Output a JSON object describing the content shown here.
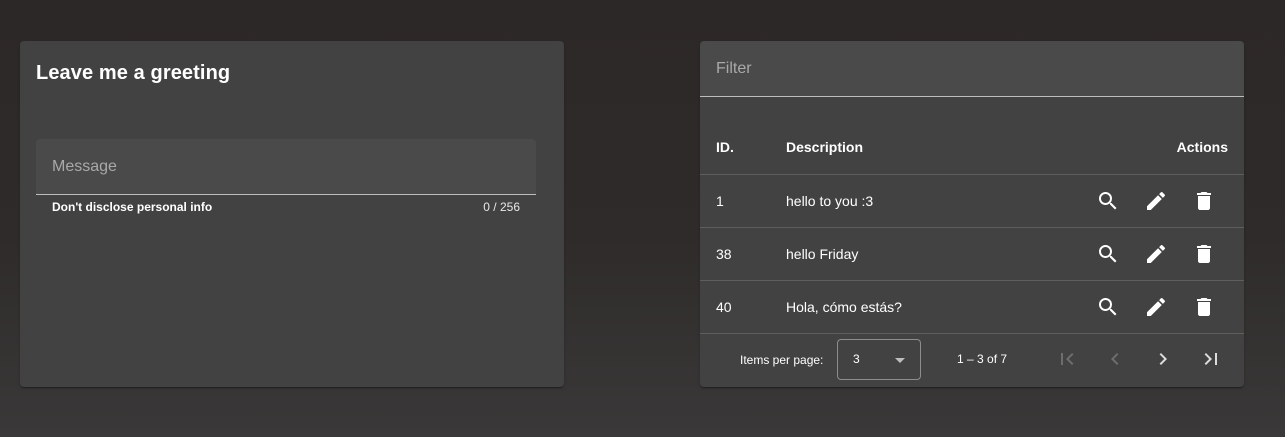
{
  "greeting_card": {
    "title": "Leave me a greeting",
    "message_field": {
      "placeholder": "Message",
      "value": "",
      "hint": "Don't disclose personal info",
      "counter": "0 / 256"
    }
  },
  "table_card": {
    "filter": {
      "placeholder": "Filter",
      "value": ""
    },
    "columns": {
      "id": "ID.",
      "description": "Description",
      "actions": "Actions"
    },
    "rows": [
      {
        "id": "1",
        "description": "hello to you :3"
      },
      {
        "id": "38",
        "description": "hello Friday"
      },
      {
        "id": "40",
        "description": "Hola, cómo estás?"
      }
    ],
    "row_actions": [
      "search-icon",
      "pencil-icon",
      "trash-icon"
    ],
    "paginator": {
      "items_per_page_label": "Items per page:",
      "items_per_page_value": "3",
      "range_label": "1 – 3 of 7",
      "first_enabled": false,
      "prev_enabled": false,
      "next_enabled": true,
      "last_enabled": true
    }
  },
  "colors": {
    "background": "#2d2828",
    "card": "#424242",
    "field": "#4a4a4a",
    "text": "#ffffff",
    "placeholder": "#a9a9a9"
  }
}
